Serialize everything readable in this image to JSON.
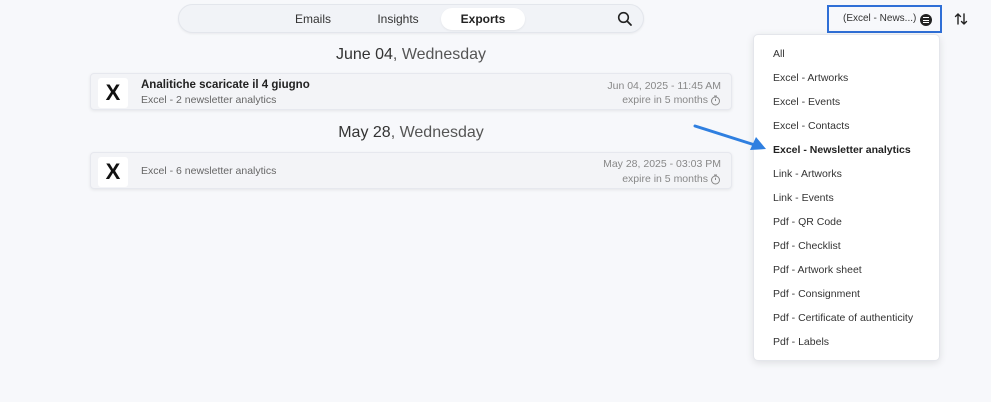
{
  "nav": {
    "tabs": [
      {
        "label": "Emails"
      },
      {
        "label": "Insights"
      },
      {
        "label": "Exports"
      }
    ],
    "active_tab": "Exports",
    "search_icon": "search-icon"
  },
  "filter": {
    "label": "(Excel - News...)",
    "icon": "filter-icon",
    "highlight_color": "#2f6fd6"
  },
  "sort_icon": "sort-icon",
  "groups": [
    {
      "date_main": "June 04",
      "date_weekday": ", Wednesday",
      "items": [
        {
          "icon_letter": "X",
          "title": "Analitiche scaricate il 4 giugno",
          "subtitle": "Excel - 2 newsletter analytics",
          "date": "Jun 04, 2025 - 11:45 AM",
          "expire": "expire in 5 months"
        }
      ]
    },
    {
      "date_main": "May 28",
      "date_weekday": ", Wednesday",
      "items": [
        {
          "icon_letter": "X",
          "title": "",
          "subtitle": "Excel - 6 newsletter analytics",
          "date": "May 28, 2025 - 03:03 PM",
          "expire": "expire in 5 months"
        }
      ]
    }
  ],
  "dropdown": {
    "options": [
      "All",
      "Excel - Artworks",
      "Excel - Events",
      "Excel - Contacts",
      "Excel - Newsletter analytics",
      "Link - Artworks",
      "Link - Events",
      "Pdf - QR Code",
      "Pdf - Checklist",
      "Pdf - Artwork sheet",
      "Pdf - Consignment",
      "Pdf - Certificate of authenticity",
      "Pdf - Labels"
    ],
    "selected": "Excel - Newsletter analytics"
  },
  "annotation_arrow_color": "#2f7fe0"
}
